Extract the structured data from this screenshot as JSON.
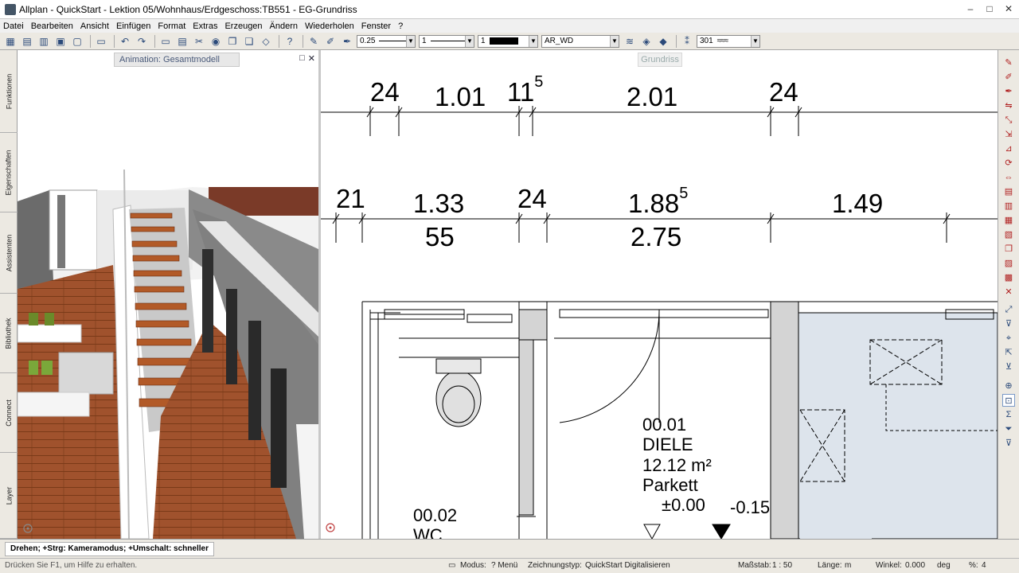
{
  "window": {
    "title": "Allplan - QuickStart - Lektion 05/Wohnhaus/Erdgeschoss:TB551 - EG-Grundriss",
    "controls": [
      "–",
      "□",
      "✕"
    ]
  },
  "menu": {
    "items": [
      "Datei",
      "Bearbeiten",
      "Ansicht",
      "Einfügen",
      "Format",
      "Extras",
      "Erzeugen",
      "Ändern",
      "Wiederholen",
      "Fenster",
      "?"
    ]
  },
  "toolbar": {
    "pen_value": "0.25",
    "line_value": "1",
    "color_value": "1",
    "layer_value": "AR_WD",
    "hatch_value": "301"
  },
  "left_tabs": [
    "Funktionen",
    "Eigenschaften",
    "Assistenten",
    "Bibliothek",
    "Connect",
    "Layer"
  ],
  "panel_3d": {
    "caption": "Animation: Gesamtmodell",
    "controls": [
      "□",
      "✕"
    ]
  },
  "panel_plan": {
    "caption": "Grundriss",
    "dims_row1": {
      "a": "24",
      "b": "1.01",
      "c_main": "11",
      "c_sup": "5",
      "d": "2.01",
      "e": "24"
    },
    "dims_row2": {
      "a": "21",
      "b": "1.33",
      "b2": "55",
      "c": "24",
      "d_main": "1.88",
      "d_sup": "5",
      "d2": "2.75",
      "e": "1.49"
    },
    "room_diele": {
      "number": "00.01",
      "name": "DIELE",
      "area": "12.12 m²",
      "floor": "Parkett",
      "level": "±0.00"
    },
    "level_right": "-0.15",
    "room_wc": {
      "number": "00.02",
      "name": "WC"
    }
  },
  "command_bar": {
    "prompt": "Drehen; +Strg: Kameramodus; +Umschalt: schneller"
  },
  "status_bar": {
    "hint": "Drücken Sie F1, um Hilfe zu erhalten.",
    "modus_label": "Modus:",
    "modus_value": "? Menü",
    "drawing_type_label": "Zeichnungstyp:",
    "drawing_type_value": "QuickStart Digitalisieren",
    "scale_label": "Maßstab:",
    "scale_value": "1 : 50",
    "length_label": "Länge:",
    "length_value": "m",
    "angle_label": "Winkel:",
    "angle_value": "0.000",
    "angle_unit": "deg",
    "percent_label": "%:",
    "percent_value": "4"
  }
}
